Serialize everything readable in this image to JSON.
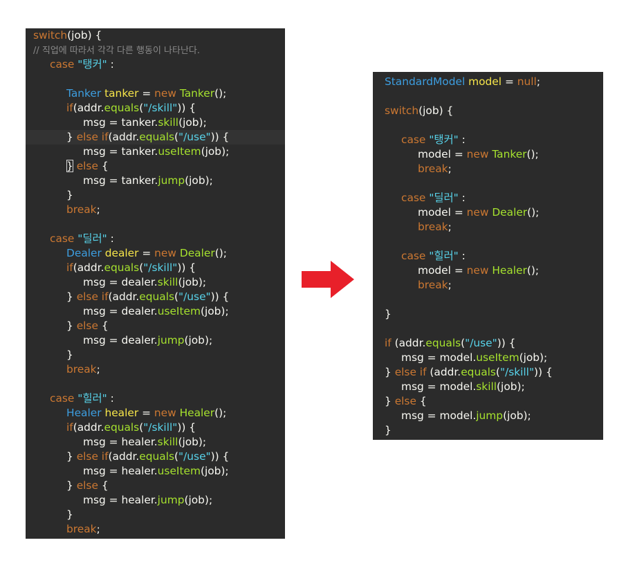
{
  "colors": {
    "background": "#ffffff",
    "editor_background": "#2b2b2b",
    "keyword": "#cc7832",
    "type": "#3d9ee0",
    "variable": "#f7e64a",
    "string": "#58d3ea",
    "method": "#a6e22e",
    "comment": "#8a8a8a",
    "plain": "#f8f8f2",
    "arrow": "#e8202a"
  },
  "arrow_icon": "right-arrow-icon",
  "left_panel": {
    "lines": [
      {
        "tokens": [
          [
            "switch",
            "kw"
          ],
          [
            "(job) {",
            "plain"
          ]
        ]
      },
      {
        "tokens": [
          [
            "// 직업에 따라서 각각 다른 행동이 나타난다.",
            "cmt"
          ]
        ],
        "indent": 0
      },
      {
        "tokens": [
          [
            "case ",
            "kw"
          ],
          [
            "\"탱커\"",
            "str"
          ],
          [
            " :",
            "plain"
          ]
        ],
        "indent": 1
      },
      {
        "tokens": []
      },
      {
        "tokens": [
          [
            "Tanker",
            "type"
          ],
          [
            " tanker",
            "var"
          ],
          [
            " = ",
            "plain"
          ],
          [
            "new ",
            "kw"
          ],
          [
            "Tanker",
            "call"
          ],
          [
            "();",
            "plain"
          ]
        ],
        "indent": 2
      },
      {
        "tokens": [
          [
            "if",
            "kw"
          ],
          [
            "(addr.",
            "plain"
          ],
          [
            "equals",
            "call"
          ],
          [
            "(",
            "plain"
          ],
          [
            "\"/skill\"",
            "str"
          ],
          [
            ")) {",
            "plain"
          ]
        ],
        "indent": 2
      },
      {
        "tokens": [
          [
            "msg = tanker.",
            "plain"
          ],
          [
            "skill",
            "call"
          ],
          [
            "(job);",
            "plain"
          ]
        ],
        "indent": 3
      },
      {
        "tokens": [
          [
            "} ",
            "plain"
          ],
          [
            "else if",
            "kw"
          ],
          [
            "(addr.",
            "plain"
          ],
          [
            "equals",
            "call"
          ],
          [
            "(",
            "plain"
          ],
          [
            "\"/use\"",
            "str"
          ],
          [
            ")) {",
            "plain"
          ]
        ],
        "indent": 2,
        "highlight": true
      },
      {
        "tokens": [
          [
            "msg = tanker.",
            "plain"
          ],
          [
            "useItem",
            "call"
          ],
          [
            "(job);",
            "plain"
          ]
        ],
        "indent": 3
      },
      {
        "tokens": [
          [
            "}",
            "cursor"
          ],
          [
            " else",
            "kw"
          ],
          [
            " {",
            "plain"
          ]
        ],
        "indent": 2
      },
      {
        "tokens": [
          [
            "msg = tanker.",
            "plain"
          ],
          [
            "jump",
            "call"
          ],
          [
            "(job);",
            "plain"
          ]
        ],
        "indent": 3
      },
      {
        "tokens": [
          [
            "}",
            "plain"
          ]
        ],
        "indent": 2
      },
      {
        "tokens": [
          [
            "break",
            "kw"
          ],
          [
            ";",
            "plain"
          ]
        ],
        "indent": 2
      },
      {
        "tokens": []
      },
      {
        "tokens": [
          [
            "case ",
            "kw"
          ],
          [
            "\"딜러\"",
            "str"
          ],
          [
            " :",
            "plain"
          ]
        ],
        "indent": 1
      },
      {
        "tokens": [
          [
            "Dealer",
            "type"
          ],
          [
            " dealer",
            "var"
          ],
          [
            " = ",
            "plain"
          ],
          [
            "new ",
            "kw"
          ],
          [
            "Dealer",
            "call"
          ],
          [
            "();",
            "plain"
          ]
        ],
        "indent": 2
      },
      {
        "tokens": [
          [
            "if",
            "kw"
          ],
          [
            "(addr.",
            "plain"
          ],
          [
            "equals",
            "call"
          ],
          [
            "(",
            "plain"
          ],
          [
            "\"/skill\"",
            "str"
          ],
          [
            ")) {",
            "plain"
          ]
        ],
        "indent": 2
      },
      {
        "tokens": [
          [
            "msg = dealer.",
            "plain"
          ],
          [
            "skill",
            "call"
          ],
          [
            "(job);",
            "plain"
          ]
        ],
        "indent": 3
      },
      {
        "tokens": [
          [
            "} ",
            "plain"
          ],
          [
            "else if",
            "kw"
          ],
          [
            "(addr.",
            "plain"
          ],
          [
            "equals",
            "call"
          ],
          [
            "(",
            "plain"
          ],
          [
            "\"/use\"",
            "str"
          ],
          [
            ")) {",
            "plain"
          ]
        ],
        "indent": 2
      },
      {
        "tokens": [
          [
            "msg = dealer.",
            "plain"
          ],
          [
            "useItem",
            "call"
          ],
          [
            "(job);",
            "plain"
          ]
        ],
        "indent": 3
      },
      {
        "tokens": [
          [
            "} ",
            "plain"
          ],
          [
            "else",
            "kw"
          ],
          [
            " {",
            "plain"
          ]
        ],
        "indent": 2
      },
      {
        "tokens": [
          [
            "msg = dealer.",
            "plain"
          ],
          [
            "jump",
            "call"
          ],
          [
            "(job);",
            "plain"
          ]
        ],
        "indent": 3
      },
      {
        "tokens": [
          [
            "}",
            "plain"
          ]
        ],
        "indent": 2
      },
      {
        "tokens": [
          [
            "break",
            "kw"
          ],
          [
            ";",
            "plain"
          ]
        ],
        "indent": 2
      },
      {
        "tokens": []
      },
      {
        "tokens": [
          [
            "case ",
            "kw"
          ],
          [
            "\"힐러\"",
            "str"
          ],
          [
            " :",
            "plain"
          ]
        ],
        "indent": 1
      },
      {
        "tokens": [
          [
            "Healer",
            "type"
          ],
          [
            " healer",
            "var"
          ],
          [
            " = ",
            "plain"
          ],
          [
            "new ",
            "kw"
          ],
          [
            "Healer",
            "call"
          ],
          [
            "();",
            "plain"
          ]
        ],
        "indent": 2
      },
      {
        "tokens": [
          [
            "if",
            "kw"
          ],
          [
            "(addr.",
            "plain"
          ],
          [
            "equals",
            "call"
          ],
          [
            "(",
            "plain"
          ],
          [
            "\"/skill\"",
            "str"
          ],
          [
            ")) {",
            "plain"
          ]
        ],
        "indent": 2
      },
      {
        "tokens": [
          [
            "msg = healer.",
            "plain"
          ],
          [
            "skill",
            "call"
          ],
          [
            "(job);",
            "plain"
          ]
        ],
        "indent": 3
      },
      {
        "tokens": [
          [
            "} ",
            "plain"
          ],
          [
            "else if",
            "kw"
          ],
          [
            "(addr.",
            "plain"
          ],
          [
            "equals",
            "call"
          ],
          [
            "(",
            "plain"
          ],
          [
            "\"/use\"",
            "str"
          ],
          [
            ")) {",
            "plain"
          ]
        ],
        "indent": 2
      },
      {
        "tokens": [
          [
            "msg = healer.",
            "plain"
          ],
          [
            "useItem",
            "call"
          ],
          [
            "(job);",
            "plain"
          ]
        ],
        "indent": 3
      },
      {
        "tokens": [
          [
            "} ",
            "plain"
          ],
          [
            "else",
            "kw"
          ],
          [
            " {",
            "plain"
          ]
        ],
        "indent": 2
      },
      {
        "tokens": [
          [
            "msg = healer.",
            "plain"
          ],
          [
            "jump",
            "call"
          ],
          [
            "(job);",
            "plain"
          ]
        ],
        "indent": 3
      },
      {
        "tokens": [
          [
            "}",
            "plain"
          ]
        ],
        "indent": 2
      },
      {
        "tokens": [
          [
            "break",
            "kw"
          ],
          [
            ";",
            "plain"
          ]
        ],
        "indent": 2
      }
    ]
  },
  "right_panel": {
    "lines": [
      {
        "tokens": [
          [
            "StandardModel",
            "type"
          ],
          [
            " model",
            "var"
          ],
          [
            " = ",
            "plain"
          ],
          [
            "null",
            "kw"
          ],
          [
            ";",
            "plain"
          ]
        ]
      },
      {
        "tokens": []
      },
      {
        "tokens": [
          [
            "switch",
            "kw"
          ],
          [
            "(job) {",
            "plain"
          ]
        ]
      },
      {
        "tokens": []
      },
      {
        "tokens": [
          [
            "case ",
            "kw"
          ],
          [
            "\"탱커\"",
            "str"
          ],
          [
            " :",
            "plain"
          ]
        ],
        "indent": 1
      },
      {
        "tokens": [
          [
            "model = ",
            "plain"
          ],
          [
            "new ",
            "kw"
          ],
          [
            "Tanker",
            "call"
          ],
          [
            "();",
            "plain"
          ]
        ],
        "indent": 2
      },
      {
        "tokens": [
          [
            "break",
            "kw"
          ],
          [
            ";",
            "plain"
          ]
        ],
        "indent": 2
      },
      {
        "tokens": []
      },
      {
        "tokens": [
          [
            "case ",
            "kw"
          ],
          [
            "\"딜러\"",
            "str"
          ],
          [
            " :",
            "plain"
          ]
        ],
        "indent": 1
      },
      {
        "tokens": [
          [
            "model = ",
            "plain"
          ],
          [
            "new ",
            "kw"
          ],
          [
            "Dealer",
            "call"
          ],
          [
            "();",
            "plain"
          ]
        ],
        "indent": 2
      },
      {
        "tokens": [
          [
            "break",
            "kw"
          ],
          [
            ";",
            "plain"
          ]
        ],
        "indent": 2
      },
      {
        "tokens": []
      },
      {
        "tokens": [
          [
            "case ",
            "kw"
          ],
          [
            "\"힐러\"",
            "str"
          ],
          [
            " :",
            "plain"
          ]
        ],
        "indent": 1
      },
      {
        "tokens": [
          [
            "model = ",
            "plain"
          ],
          [
            "new ",
            "kw"
          ],
          [
            "Healer",
            "call"
          ],
          [
            "();",
            "plain"
          ]
        ],
        "indent": 2
      },
      {
        "tokens": [
          [
            "break",
            "kw"
          ],
          [
            ";",
            "plain"
          ]
        ],
        "indent": 2
      },
      {
        "tokens": []
      },
      {
        "tokens": [
          [
            "}",
            "plain"
          ]
        ]
      },
      {
        "tokens": []
      },
      {
        "tokens": [
          [
            "if",
            "kw"
          ],
          [
            " (addr.",
            "plain"
          ],
          [
            "equals",
            "call"
          ],
          [
            "(",
            "plain"
          ],
          [
            "\"/use\"",
            "str"
          ],
          [
            ")) {",
            "plain"
          ]
        ]
      },
      {
        "tokens": [
          [
            "msg = model.",
            "plain"
          ],
          [
            "useItem",
            "call"
          ],
          [
            "(job);",
            "plain"
          ]
        ],
        "indent": 1
      },
      {
        "tokens": [
          [
            "} ",
            "plain"
          ],
          [
            "else if",
            "kw"
          ],
          [
            " (addr.",
            "plain"
          ],
          [
            "equals",
            "call"
          ],
          [
            "(",
            "plain"
          ],
          [
            "\"/skill\"",
            "str"
          ],
          [
            ")) {",
            "plain"
          ]
        ]
      },
      {
        "tokens": [
          [
            "msg = model.",
            "plain"
          ],
          [
            "skill",
            "call"
          ],
          [
            "(job);",
            "plain"
          ]
        ],
        "indent": 1
      },
      {
        "tokens": [
          [
            "} ",
            "plain"
          ],
          [
            "else",
            "kw"
          ],
          [
            " {",
            "plain"
          ]
        ]
      },
      {
        "tokens": [
          [
            "msg = model.",
            "plain"
          ],
          [
            "jump",
            "call"
          ],
          [
            "(job);",
            "plain"
          ]
        ],
        "indent": 1
      },
      {
        "tokens": [
          [
            "}",
            "plain"
          ]
        ]
      }
    ]
  }
}
